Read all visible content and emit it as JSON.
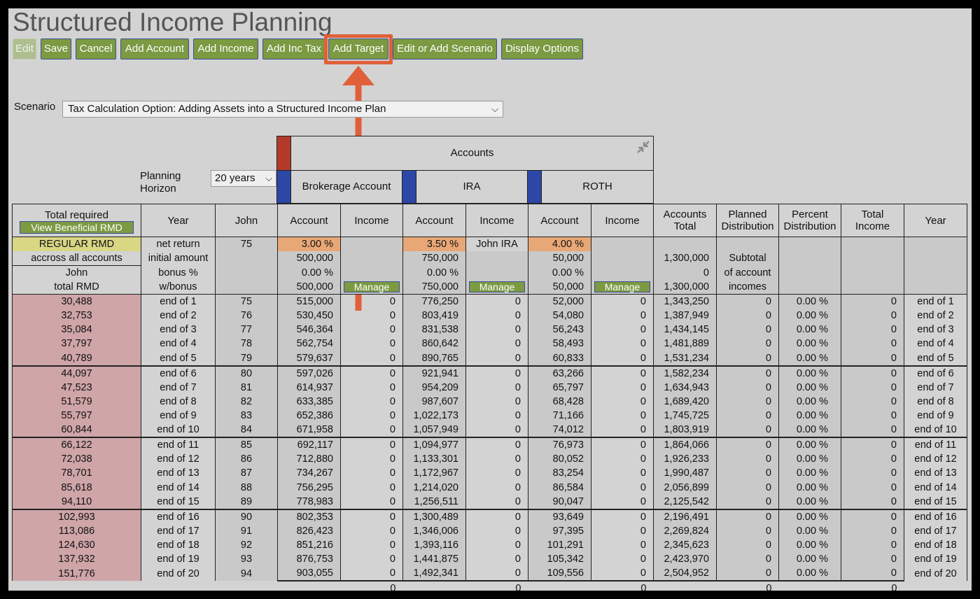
{
  "title": "Structured Income Planning",
  "toolbar": [
    {
      "label": "Edit",
      "disabled": true
    },
    {
      "label": "Save"
    },
    {
      "label": "Cancel"
    },
    {
      "label": "Add Account"
    },
    {
      "label": "Add Income"
    },
    {
      "label": "Add Inc Tax"
    },
    {
      "label": "Add Target"
    },
    {
      "label": "Edit or Add Scenario"
    },
    {
      "label": "Display Options"
    }
  ],
  "scenario": {
    "label": "Scenario",
    "value": "Tax Calculation Option: Adding Assets into a Structured Income Plan"
  },
  "planning_horizon": {
    "label_line1": "Planning",
    "label_line2": "Horizon",
    "value": "20 years"
  },
  "accounts_header": "Accounts",
  "accounts": [
    {
      "name": "Brokerage Account"
    },
    {
      "name": "IRA"
    },
    {
      "name": "ROTH"
    }
  ],
  "columns": {
    "total_required": "Total required",
    "view_rmd": "View Beneficial RMD",
    "year": "Year",
    "john": "John",
    "account": "Account",
    "income": "Income",
    "accounts_total_1": "Accounts",
    "accounts_total_2": "Total",
    "planned_1": "Planned",
    "planned_2": "Distribution",
    "percent_1": "Percent",
    "percent_2": "Distribution",
    "total_income_1": "Total",
    "total_income_2": "Income",
    "year2": "Year"
  },
  "param_rows": {
    "col0": [
      "REGULAR RMD",
      "accross all accounts",
      "John",
      "total RMD"
    ],
    "col1": [
      "net return",
      "initial amount",
      "bonus %",
      "w/bonus"
    ],
    "john_age": "75",
    "brokerage": {
      "rate": "3.00  %",
      "initial": "500,000",
      "bonus": "0.00  %",
      "wbonus": "500,000"
    },
    "ira": {
      "rate": "3.50  %",
      "initial": "750,000",
      "bonus": "0.00  %",
      "wbonus": "750,000",
      "income_label": "John IRA"
    },
    "roth": {
      "rate": "4.00  %",
      "initial": "50,000",
      "bonus": "0.00  %",
      "wbonus": "50,000"
    },
    "manage": "Manage",
    "accounts_total": {
      "initial": "1,300,000",
      "bonus": "0",
      "wbonus": "1,300,000"
    },
    "planned": [
      "Subtotal",
      "of account",
      "incomes"
    ]
  },
  "rows": [
    {
      "rmd": "30,488",
      "year": "end of 1",
      "age": "75",
      "b": "515,000",
      "bi": "0",
      "i": "776,250",
      "ii": "0",
      "r": "52,000",
      "ri": "0",
      "tot": "1,343,250",
      "pd": "0",
      "pct": "0.00  %",
      "ti": "0",
      "y2": "end of 1"
    },
    {
      "rmd": "32,753",
      "year": "end of 2",
      "age": "76",
      "b": "530,450",
      "bi": "0",
      "i": "803,419",
      "ii": "0",
      "r": "54,080",
      "ri": "0",
      "tot": "1,387,949",
      "pd": "0",
      "pct": "0.00  %",
      "ti": "0",
      "y2": "end of 2"
    },
    {
      "rmd": "35,084",
      "year": "end of 3",
      "age": "77",
      "b": "546,364",
      "bi": "0",
      "i": "831,538",
      "ii": "0",
      "r": "56,243",
      "ri": "0",
      "tot": "1,434,145",
      "pd": "0",
      "pct": "0.00  %",
      "ti": "0",
      "y2": "end of 3"
    },
    {
      "rmd": "37,797",
      "year": "end of 4",
      "age": "78",
      "b": "562,754",
      "bi": "0",
      "i": "860,642",
      "ii": "0",
      "r": "58,493",
      "ri": "0",
      "tot": "1,481,889",
      "pd": "0",
      "pct": "0.00  %",
      "ti": "0",
      "y2": "end of 4"
    },
    {
      "rmd": "40,789",
      "year": "end of 5",
      "age": "79",
      "b": "579,637",
      "bi": "0",
      "i": "890,765",
      "ii": "0",
      "r": "60,833",
      "ri": "0",
      "tot": "1,531,234",
      "pd": "0",
      "pct": "0.00  %",
      "ti": "0",
      "y2": "end of 5"
    },
    {
      "rmd": "44,097",
      "year": "end of 6",
      "age": "80",
      "b": "597,026",
      "bi": "0",
      "i": "921,941",
      "ii": "0",
      "r": "63,266",
      "ri": "0",
      "tot": "1,582,234",
      "pd": "0",
      "pct": "0.00  %",
      "ti": "0",
      "y2": "end of 6"
    },
    {
      "rmd": "47,523",
      "year": "end of 7",
      "age": "81",
      "b": "614,937",
      "bi": "0",
      "i": "954,209",
      "ii": "0",
      "r": "65,797",
      "ri": "0",
      "tot": "1,634,943",
      "pd": "0",
      "pct": "0.00  %",
      "ti": "0",
      "y2": "end of 7"
    },
    {
      "rmd": "51,579",
      "year": "end of 8",
      "age": "82",
      "b": "633,385",
      "bi": "0",
      "i": "987,607",
      "ii": "0",
      "r": "68,428",
      "ri": "0",
      "tot": "1,689,420",
      "pd": "0",
      "pct": "0.00  %",
      "ti": "0",
      "y2": "end of 8"
    },
    {
      "rmd": "55,797",
      "year": "end of 9",
      "age": "83",
      "b": "652,386",
      "bi": "0",
      "i": "1,022,173",
      "ii": "0",
      "r": "71,166",
      "ri": "0",
      "tot": "1,745,725",
      "pd": "0",
      "pct": "0.00  %",
      "ti": "0",
      "y2": "end of 9"
    },
    {
      "rmd": "60,844",
      "year": "end of 10",
      "age": "84",
      "b": "671,958",
      "bi": "0",
      "i": "1,057,949",
      "ii": "0",
      "r": "74,012",
      "ri": "0",
      "tot": "1,803,919",
      "pd": "0",
      "pct": "0.00  %",
      "ti": "0",
      "y2": "end of 10"
    },
    {
      "rmd": "66,122",
      "year": "end of 11",
      "age": "85",
      "b": "692,117",
      "bi": "0",
      "i": "1,094,977",
      "ii": "0",
      "r": "76,973",
      "ri": "0",
      "tot": "1,864,066",
      "pd": "0",
      "pct": "0.00  %",
      "ti": "0",
      "y2": "end of 11"
    },
    {
      "rmd": "72,038",
      "year": "end of 12",
      "age": "86",
      "b": "712,880",
      "bi": "0",
      "i": "1,133,301",
      "ii": "0",
      "r": "80,052",
      "ri": "0",
      "tot": "1,926,233",
      "pd": "0",
      "pct": "0.00  %",
      "ti": "0",
      "y2": "end of 12"
    },
    {
      "rmd": "78,701",
      "year": "end of 13",
      "age": "87",
      "b": "734,267",
      "bi": "0",
      "i": "1,172,967",
      "ii": "0",
      "r": "83,254",
      "ri": "0",
      "tot": "1,990,487",
      "pd": "0",
      "pct": "0.00  %",
      "ti": "0",
      "y2": "end of 13"
    },
    {
      "rmd": "85,618",
      "year": "end of 14",
      "age": "88",
      "b": "756,295",
      "bi": "0",
      "i": "1,214,020",
      "ii": "0",
      "r": "86,584",
      "ri": "0",
      "tot": "2,056,899",
      "pd": "0",
      "pct": "0.00  %",
      "ti": "0",
      "y2": "end of 14"
    },
    {
      "rmd": "94,110",
      "year": "end of 15",
      "age": "89",
      "b": "778,983",
      "bi": "0",
      "i": "1,256,511",
      "ii": "0",
      "r": "90,047",
      "ri": "0",
      "tot": "2,125,542",
      "pd": "0",
      "pct": "0.00  %",
      "ti": "0",
      "y2": "end of 15"
    },
    {
      "rmd": "102,993",
      "year": "end of 16",
      "age": "90",
      "b": "802,353",
      "bi": "0",
      "i": "1,300,489",
      "ii": "0",
      "r": "93,649",
      "ri": "0",
      "tot": "2,196,491",
      "pd": "0",
      "pct": "0.00  %",
      "ti": "0",
      "y2": "end of 16"
    },
    {
      "rmd": "113,086",
      "year": "end of 17",
      "age": "91",
      "b": "826,423",
      "bi": "0",
      "i": "1,346,006",
      "ii": "0",
      "r": "97,395",
      "ri": "0",
      "tot": "2,269,824",
      "pd": "0",
      "pct": "0.00  %",
      "ti": "0",
      "y2": "end of 17"
    },
    {
      "rmd": "124,630",
      "year": "end of 18",
      "age": "92",
      "b": "851,216",
      "bi": "0",
      "i": "1,393,116",
      "ii": "0",
      "r": "101,291",
      "ri": "0",
      "tot": "2,345,623",
      "pd": "0",
      "pct": "0.00  %",
      "ti": "0",
      "y2": "end of 18"
    },
    {
      "rmd": "137,932",
      "year": "end of 19",
      "age": "93",
      "b": "876,753",
      "bi": "0",
      "i": "1,441,875",
      "ii": "0",
      "r": "105,342",
      "ri": "0",
      "tot": "2,423,970",
      "pd": "0",
      "pct": "0.00  %",
      "ti": "0",
      "y2": "end of 19"
    },
    {
      "rmd": "151,776",
      "year": "end of 20",
      "age": "94",
      "b": "903,055",
      "bi": "0",
      "i": "1,492,341",
      "ii": "0",
      "r": "109,556",
      "ri": "0",
      "tot": "2,504,952",
      "pd": "0",
      "pct": "0.00  %",
      "ti": "0",
      "y2": "end of 20"
    }
  ],
  "totals": {
    "brokerage_income": "0",
    "ira_income": "0",
    "roth_income": "0",
    "planned": "0",
    "total_income": "0"
  },
  "colors": {
    "accent": "#7b9a42",
    "highlight": "#e0603a",
    "account_blue": "#2c47a6",
    "accounts_red": "#b33a2a",
    "rmd_pink": "#cfa5a8",
    "rate_orange": "#e8a776",
    "rmd_yellow": "#d9d684"
  }
}
